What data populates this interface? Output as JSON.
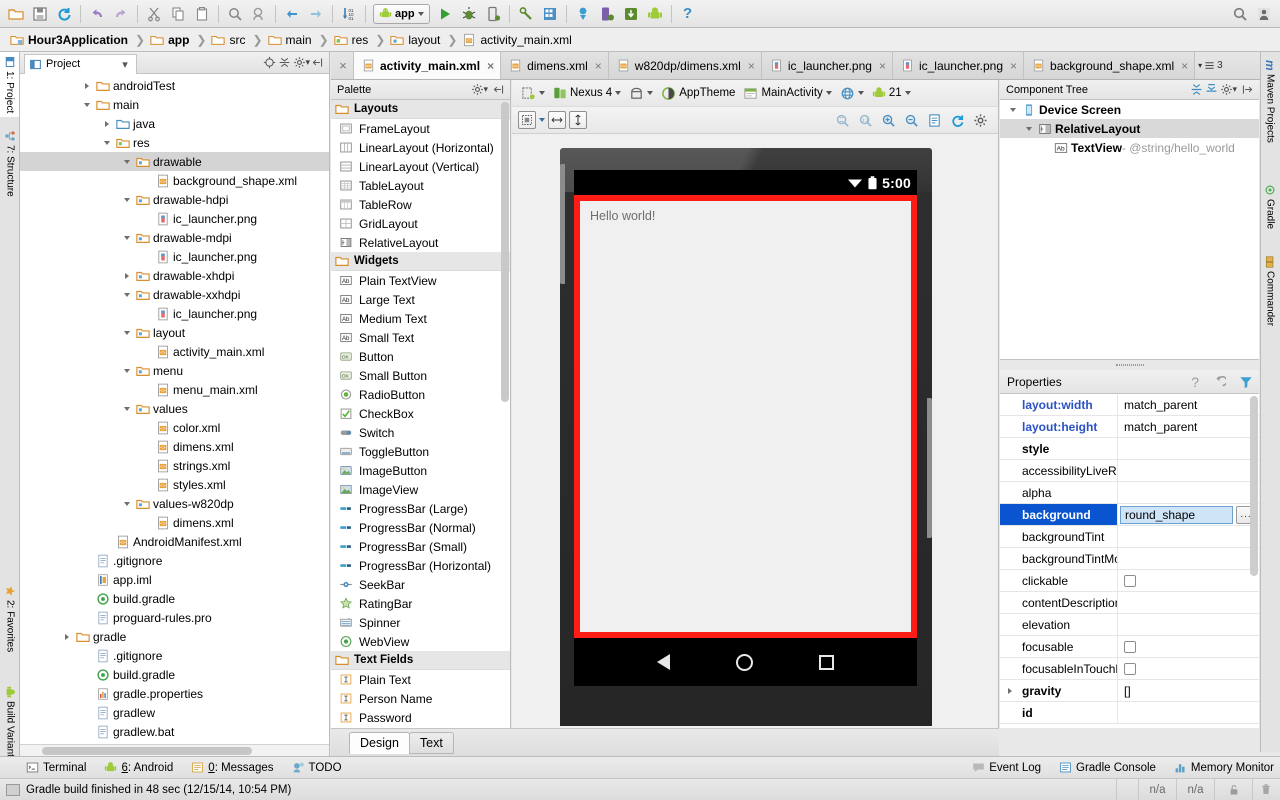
{
  "window": {
    "title": "Hour3Application - activity_main.xml"
  },
  "toolbar": {
    "icons": [
      "open-folder-icon",
      "save-all-icon",
      "sync-icon",
      "undo-icon",
      "redo-icon",
      "cut-icon",
      "copy-icon",
      "paste-icon",
      "find-icon",
      "find-replace-icon",
      "back-icon",
      "forward-icon",
      "sort-icon"
    ],
    "run_config": "app",
    "run_config_caret": "▾",
    "action_icons": [
      "run-icon",
      "debug-icon",
      "attach-debugger-icon",
      "sdk-manager-icon",
      "avd-manager-icon",
      "sync-gradle-icon",
      "android-monitor-icon",
      "download-icon",
      "android-device-icon"
    ],
    "help_label": "?",
    "search_icon": "search-icon",
    "account_icon": "account-icon"
  },
  "breadcrumb": {
    "items": [
      {
        "label": "Hour3Application",
        "icon": "module-icon",
        "bold": true
      },
      {
        "label": "app",
        "icon": "folder-icon",
        "bold": true
      },
      {
        "label": "src",
        "icon": "folder-icon",
        "bold": false
      },
      {
        "label": "main",
        "icon": "folder-icon",
        "bold": false
      },
      {
        "label": "res",
        "icon": "res-folder-icon",
        "bold": false
      },
      {
        "label": "layout",
        "icon": "res-folder-icon",
        "bold": false
      },
      {
        "label": "activity_main.xml",
        "icon": "xml-file-icon",
        "bold": false
      }
    ],
    "separator": "❯"
  },
  "left_rail": {
    "tabs": [
      {
        "label": "1: Project",
        "icon": "project-icon",
        "selected": true
      },
      {
        "label": "7: Structure",
        "icon": "structure-icon",
        "selected": false
      },
      {
        "label": "2: Favorites",
        "icon": "star-icon",
        "selected": false
      },
      {
        "label": "Build Variants",
        "icon": "android-icon",
        "selected": false
      }
    ]
  },
  "right_rail": {
    "tabs": [
      {
        "label": "Maven Projects",
        "icon": "maven-icon"
      },
      {
        "label": "Gradle",
        "icon": "gradle-icon"
      },
      {
        "label": "Commander",
        "icon": "commander-icon"
      }
    ]
  },
  "project_panel": {
    "title": "Project",
    "title_caret": "▾",
    "header_icons": [
      "target-icon",
      "collapse-all-icon",
      "gear-icon",
      "hide-icon"
    ],
    "tree": [
      {
        "label": "androidTest",
        "indent": 3,
        "arrow": "closed",
        "icon": "folder-icon"
      },
      {
        "label": "main",
        "indent": 3,
        "arrow": "open",
        "icon": "folder-icon"
      },
      {
        "label": "java",
        "indent": 4,
        "arrow": "closed",
        "icon": "source-folder-icon"
      },
      {
        "label": "res",
        "indent": 4,
        "arrow": "open",
        "icon": "res-folder-icon"
      },
      {
        "label": "drawable",
        "indent": 5,
        "arrow": "open",
        "icon": "res-subfolder-icon",
        "selected": true
      },
      {
        "label": "background_shape.xml",
        "indent": 6,
        "arrow": "none",
        "icon": "xml-file-icon"
      },
      {
        "label": "drawable-hdpi",
        "indent": 5,
        "arrow": "open",
        "icon": "res-subfolder-icon"
      },
      {
        "label": "ic_launcher.png",
        "indent": 6,
        "arrow": "none",
        "icon": "png-file-icon"
      },
      {
        "label": "drawable-mdpi",
        "indent": 5,
        "arrow": "open",
        "icon": "res-subfolder-icon"
      },
      {
        "label": "ic_launcher.png",
        "indent": 6,
        "arrow": "none",
        "icon": "png-file-icon"
      },
      {
        "label": "drawable-xhdpi",
        "indent": 5,
        "arrow": "closed",
        "icon": "res-subfolder-icon"
      },
      {
        "label": "drawable-xxhdpi",
        "indent": 5,
        "arrow": "open",
        "icon": "res-subfolder-icon"
      },
      {
        "label": "ic_launcher.png",
        "indent": 6,
        "arrow": "none",
        "icon": "png-file-icon"
      },
      {
        "label": "layout",
        "indent": 5,
        "arrow": "open",
        "icon": "res-subfolder-icon"
      },
      {
        "label": "activity_main.xml",
        "indent": 6,
        "arrow": "none",
        "icon": "xml-file-icon"
      },
      {
        "label": "menu",
        "indent": 5,
        "arrow": "open",
        "icon": "res-subfolder-icon"
      },
      {
        "label": "menu_main.xml",
        "indent": 6,
        "arrow": "none",
        "icon": "xml-file-icon"
      },
      {
        "label": "values",
        "indent": 5,
        "arrow": "open",
        "icon": "res-subfolder-icon"
      },
      {
        "label": "color.xml",
        "indent": 6,
        "arrow": "none",
        "icon": "xml-file-icon"
      },
      {
        "label": "dimens.xml",
        "indent": 6,
        "arrow": "none",
        "icon": "xml-file-icon"
      },
      {
        "label": "strings.xml",
        "indent": 6,
        "arrow": "none",
        "icon": "xml-file-icon"
      },
      {
        "label": "styles.xml",
        "indent": 6,
        "arrow": "none",
        "icon": "xml-file-icon"
      },
      {
        "label": "values-w820dp",
        "indent": 5,
        "arrow": "open",
        "icon": "res-subfolder-icon"
      },
      {
        "label": "dimens.xml",
        "indent": 6,
        "arrow": "none",
        "icon": "xml-file-icon"
      },
      {
        "label": "AndroidManifest.xml",
        "indent": 4,
        "arrow": "none",
        "icon": "manifest-file-icon"
      },
      {
        "label": ".gitignore",
        "indent": 3,
        "arrow": "none",
        "icon": "text-file-icon"
      },
      {
        "label": "app.iml",
        "indent": 3,
        "arrow": "none",
        "icon": "iml-file-icon"
      },
      {
        "label": "build.gradle",
        "indent": 3,
        "arrow": "none",
        "icon": "gradle-file-icon"
      },
      {
        "label": "proguard-rules.pro",
        "indent": 3,
        "arrow": "none",
        "icon": "text-file-icon"
      },
      {
        "label": "gradle",
        "indent": 2,
        "arrow": "closed",
        "icon": "folder-icon"
      },
      {
        "label": ".gitignore",
        "indent": 3,
        "arrow": "none",
        "icon": "text-file-icon"
      },
      {
        "label": "build.gradle",
        "indent": 3,
        "arrow": "none",
        "icon": "gradle-file-icon"
      },
      {
        "label": "gradle.properties",
        "indent": 3,
        "arrow": "none",
        "icon": "properties-file-icon"
      },
      {
        "label": "gradlew",
        "indent": 3,
        "arrow": "none",
        "icon": "text-file-icon"
      },
      {
        "label": "gradlew.bat",
        "indent": 3,
        "arrow": "none",
        "icon": "text-file-icon"
      }
    ]
  },
  "editor_tabs": {
    "close_glyph": "×",
    "tabs": [
      {
        "label": "activity_main.xml",
        "icon": "xml-file-icon",
        "active": true
      },
      {
        "label": "dimens.xml",
        "icon": "xml-file-icon",
        "active": false
      },
      {
        "label": "w820dp/dimens.xml",
        "icon": "xml-file-icon",
        "active": false
      },
      {
        "label": "ic_launcher.png",
        "icon": "png-file-icon",
        "active": false
      },
      {
        "label": "ic_launcher.png",
        "icon": "png-file-icon",
        "active": false
      },
      {
        "label": "background_shape.xml",
        "icon": "xml-file-icon",
        "active": false
      }
    ],
    "overflow_count": "3"
  },
  "palette": {
    "title": "Palette",
    "header_icons": [
      "gear-icon",
      "hide-icon"
    ],
    "groups": [
      {
        "name": "Layouts",
        "items": [
          {
            "label": "FrameLayout",
            "icon": "frame-layout-icon"
          },
          {
            "label": "LinearLayout (Horizontal)",
            "icon": "linear-layout-h-icon"
          },
          {
            "label": "LinearLayout (Vertical)",
            "icon": "linear-layout-v-icon"
          },
          {
            "label": "TableLayout",
            "icon": "table-layout-icon"
          },
          {
            "label": "TableRow",
            "icon": "table-row-icon"
          },
          {
            "label": "GridLayout",
            "icon": "grid-layout-icon"
          },
          {
            "label": "RelativeLayout",
            "icon": "relative-layout-icon"
          }
        ]
      },
      {
        "name": "Widgets",
        "items": [
          {
            "label": "Plain TextView",
            "icon": "text-ab-icon"
          },
          {
            "label": "Large Text",
            "icon": "text-ab-icon"
          },
          {
            "label": "Medium Text",
            "icon": "text-ab-icon"
          },
          {
            "label": "Small Text",
            "icon": "text-ab-icon"
          },
          {
            "label": "Button",
            "icon": "button-ok-icon"
          },
          {
            "label": "Small Button",
            "icon": "button-ok-icon"
          },
          {
            "label": "RadioButton",
            "icon": "radio-button-icon"
          },
          {
            "label": "CheckBox",
            "icon": "checkbox-icon"
          },
          {
            "label": "Switch",
            "icon": "switch-icon"
          },
          {
            "label": "ToggleButton",
            "icon": "toggle-button-icon"
          },
          {
            "label": "ImageButton",
            "icon": "image-button-icon"
          },
          {
            "label": "ImageView",
            "icon": "image-view-icon"
          },
          {
            "label": "ProgressBar (Large)",
            "icon": "progressbar-icon"
          },
          {
            "label": "ProgressBar (Normal)",
            "icon": "progressbar-icon"
          },
          {
            "label": "ProgressBar (Small)",
            "icon": "progressbar-icon"
          },
          {
            "label": "ProgressBar (Horizontal)",
            "icon": "progressbar-icon"
          },
          {
            "label": "SeekBar",
            "icon": "seekbar-icon"
          },
          {
            "label": "RatingBar",
            "icon": "star-icon"
          },
          {
            "label": "Spinner",
            "icon": "spinner-icon"
          },
          {
            "label": "WebView",
            "icon": "webview-icon"
          }
        ]
      },
      {
        "name": "Text Fields",
        "items": [
          {
            "label": "Plain Text",
            "icon": "text-field-icon"
          },
          {
            "label": "Person Name",
            "icon": "text-field-icon"
          },
          {
            "label": "Password",
            "icon": "text-field-icon"
          }
        ]
      }
    ]
  },
  "design_toolbar": {
    "row1": [
      {
        "label": "",
        "icon": "layout-variant-icon",
        "caret": true
      },
      {
        "label": "Nexus 4",
        "icon": "device-icon",
        "caret": true
      },
      {
        "label": "",
        "icon": "orientation-icon",
        "caret": true
      },
      {
        "label": "AppTheme",
        "icon": "theme-icon",
        "caret": false
      },
      {
        "label": "MainActivity",
        "icon": "activity-icon",
        "caret": true
      },
      {
        "label": "",
        "icon": "locale-globe-icon",
        "caret": true
      },
      {
        "label": "21",
        "icon": "android-icon",
        "caret": true
      }
    ],
    "row2_left": [
      {
        "icon": "zoom-fit-icon",
        "caret": true
      },
      {
        "icon": "fit-width-icon",
        "caret": false
      },
      {
        "icon": "fit-height-icon",
        "caret": false
      }
    ],
    "row2_right": [
      "zoom-to-fit-icon",
      "zoom-actual-icon",
      "zoom-in-icon",
      "zoom-out-icon",
      "render-log-icon",
      "refresh-icon",
      "gear-icon"
    ]
  },
  "preview": {
    "status_time": "5:00",
    "wifi_icon": "wifi-icon",
    "battery_icon": "battery-icon",
    "content_text": "Hello world!",
    "background_color": "#ff1b16",
    "nav_back_icon": "nav-back-icon",
    "nav_home_icon": "nav-home-icon",
    "nav_recents_icon": "nav-recents-icon"
  },
  "design_tabs": {
    "tabs": [
      {
        "label": "Design",
        "active": true
      },
      {
        "label": "Text",
        "active": false
      }
    ]
  },
  "component_tree": {
    "title": "Component Tree",
    "header_icons": [
      "expand-all-icon",
      "collapse-all-icon",
      "gear-icon",
      "hide-icon"
    ],
    "rows": [
      {
        "label": "Device Screen",
        "suffix": "",
        "indent": 0,
        "arrow": "open",
        "icon": "device-screen-icon",
        "selected": false
      },
      {
        "label": "RelativeLayout",
        "suffix": "",
        "indent": 1,
        "arrow": "open",
        "icon": "relative-layout-icon",
        "selected": true
      },
      {
        "label": "TextView",
        "suffix": " - @string/hello_world",
        "indent": 2,
        "arrow": "none",
        "icon": "text-ab-icon",
        "selected": false
      }
    ]
  },
  "properties": {
    "title": "Properties",
    "help_glyph": "?",
    "header_icons": [
      "help-icon",
      "restore-default-icon",
      "filter-icon"
    ],
    "rows": [
      {
        "name": "layout:width",
        "value": "match_parent",
        "style": "blue",
        "control": "text"
      },
      {
        "name": "layout:height",
        "value": "match_parent",
        "style": "blue",
        "control": "text"
      },
      {
        "name": "style",
        "value": "",
        "style": "bold",
        "control": "text"
      },
      {
        "name": "accessibilityLiveRegion",
        "value": "",
        "style": "normal",
        "control": "text"
      },
      {
        "name": "alpha",
        "value": "",
        "style": "normal",
        "control": "text"
      },
      {
        "name": "background",
        "value": "round_shape",
        "style": "selected",
        "control": "editor"
      },
      {
        "name": "backgroundTint",
        "value": "",
        "style": "normal",
        "control": "text"
      },
      {
        "name": "backgroundTintMode",
        "value": "",
        "style": "normal",
        "control": "text"
      },
      {
        "name": "clickable",
        "value": "",
        "style": "normal",
        "control": "checkbox"
      },
      {
        "name": "contentDescription",
        "value": "",
        "style": "normal",
        "control": "text"
      },
      {
        "name": "elevation",
        "value": "",
        "style": "normal",
        "control": "text"
      },
      {
        "name": "focusable",
        "value": "",
        "style": "normal",
        "control": "checkbox"
      },
      {
        "name": "focusableInTouchMode",
        "value": "",
        "style": "normal",
        "control": "checkbox"
      },
      {
        "name": "gravity",
        "value": "[]",
        "style": "bold",
        "control": "text",
        "expandable": true
      },
      {
        "name": "id",
        "value": "",
        "style": "bold",
        "control": "text"
      }
    ],
    "editor_ellipsis": "..."
  },
  "tool_windows": {
    "items": [
      {
        "label": "Terminal",
        "icon": "terminal-icon",
        "mnemonic": ""
      },
      {
        "label": "6: Android",
        "icon": "android-icon",
        "mnemonic": "6"
      },
      {
        "label": "0: Messages",
        "icon": "messages-icon",
        "mnemonic": "0"
      },
      {
        "label": "TODO",
        "icon": "todo-icon",
        "mnemonic": ""
      }
    ],
    "right_items": [
      {
        "label": "Event Log",
        "icon": "event-log-icon"
      },
      {
        "label": "Gradle Console",
        "icon": "gradle-console-icon"
      },
      {
        "label": "Memory Monitor",
        "icon": "memory-monitor-icon"
      }
    ]
  },
  "status_bar": {
    "message": "Gradle build finished in 48 sec (12/15/14, 10:54 PM)",
    "cells": [
      "n/a",
      "n/a"
    ],
    "lock_icon": "unlock-icon",
    "trash_icon": "trash-icon"
  }
}
